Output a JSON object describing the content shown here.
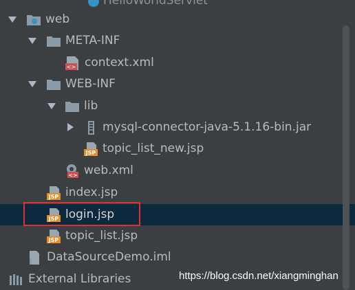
{
  "tree": {
    "top_partial": "HelloWorldServlet",
    "web": "web",
    "meta_inf": "META-INF",
    "context_xml": "context.xml",
    "web_inf": "WEB-INF",
    "lib": "lib",
    "mysql_jar": "mysql-connector-java-5.1.16-bin.jar",
    "topic_list_new": "topic_list_new.jsp",
    "web_xml": "web.xml",
    "index_jsp": "index.jsp",
    "login_jsp": "login.jsp",
    "topic_list": "topic_list.jsp",
    "iml": "DataSourceDemo.iml",
    "external_libraries": "External Libraries"
  },
  "icon_text": {
    "jsp": "JSP",
    "xml": "<>"
  },
  "watermark": "https://blog.csdn.net/xiangminghan",
  "colors": {
    "background": "#3c3f41",
    "selected_row": "#0d293e",
    "highlight_border": "#e0312f",
    "folder": "#8c9ba8",
    "jsp_icon": "#e58e2d",
    "text": "#bbbbbb"
  }
}
